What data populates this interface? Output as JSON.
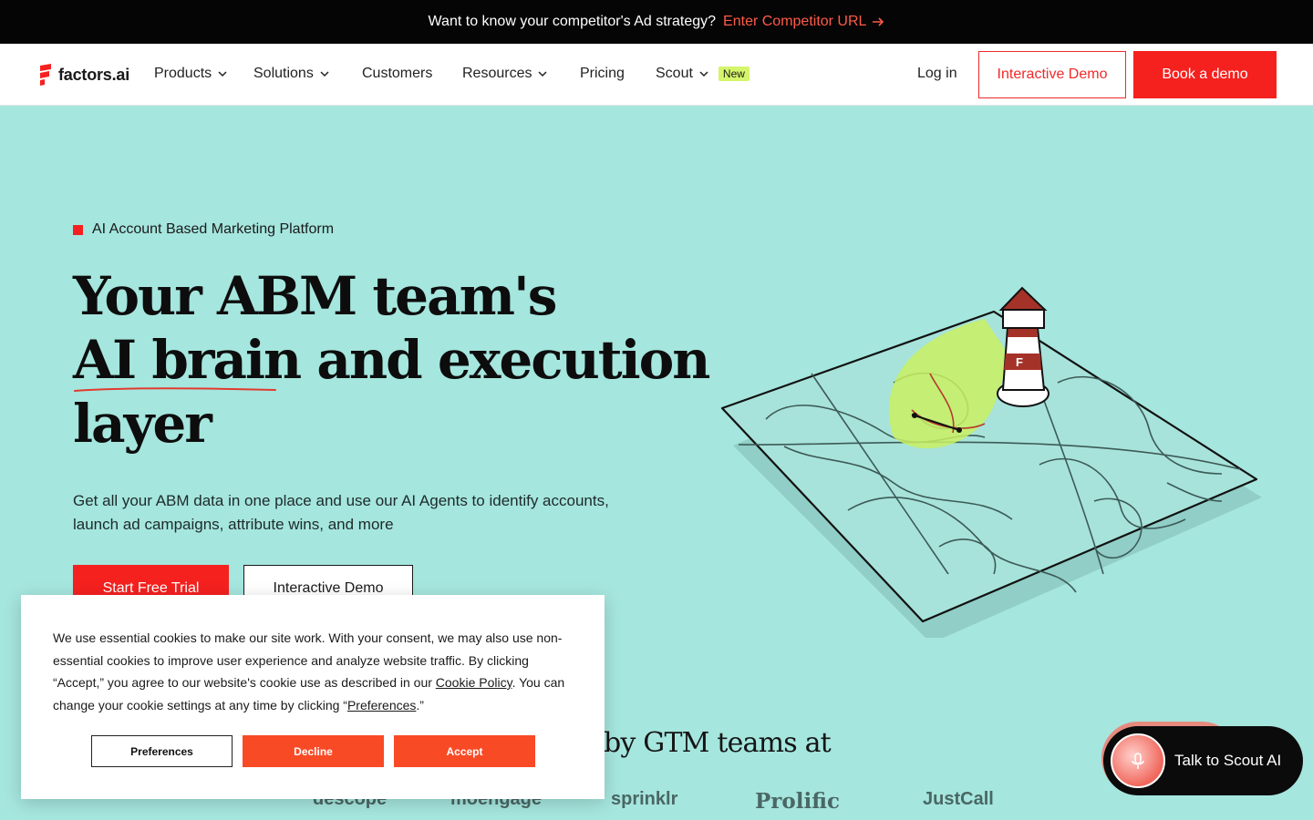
{
  "topbar": {
    "question": "Want to know your competitor's Ad strategy?",
    "cta": "Enter Competitor URL"
  },
  "nav": {
    "logo_text": "factors.ai",
    "items": [
      {
        "label": "Products"
      },
      {
        "label": "Solutions"
      },
      {
        "label": "Customers"
      },
      {
        "label": "Resources"
      },
      {
        "label": "Pricing"
      },
      {
        "label": "Scout",
        "badge": "New"
      }
    ],
    "login": "Log in",
    "interactive_demo": "Interactive Demo",
    "book_demo": "Book a demo"
  },
  "hero": {
    "eyebrow": "AI Account Based Marketing Platform",
    "headline_lines": [
      "Your ABM team's",
      "AI brain and execution",
      "layer"
    ],
    "subtext": "Get all your ABM data in one place and use our AI Agents to identify accounts, launch ad campaigns, attribute wins, and more",
    "primary_cta": "Start Free Trial",
    "secondary_cta": "Interactive Demo"
  },
  "trusted": {
    "heading_visible": "by GTM teams at",
    "logos": [
      "descope",
      "moengage",
      "sprinklr",
      "Prolific",
      "JustCall"
    ]
  },
  "cookie": {
    "text_1": "We use essential cookies to make our site work. With your consent, we may also use non-essential cookies to improve user experience and analyze website traffic. By clicking “Accept,” you agree to our website's cookie use as described in our ",
    "link_policy": "Cookie Policy",
    "text_2": ". You can change your cookie settings at any time by clicking “",
    "link_prefs": "Preferences",
    "text_3": ".”",
    "preferences": "Preferences",
    "decline": "Decline",
    "accept": "Accept"
  },
  "scout_widget": {
    "label": "Talk to Scout AI"
  },
  "colors": {
    "brand_red": "#f5211f",
    "hero_bg": "#a5e6de",
    "topbar_bg": "#050505",
    "new_badge": "#d5f56b",
    "cookie_button": "#f94a26"
  }
}
